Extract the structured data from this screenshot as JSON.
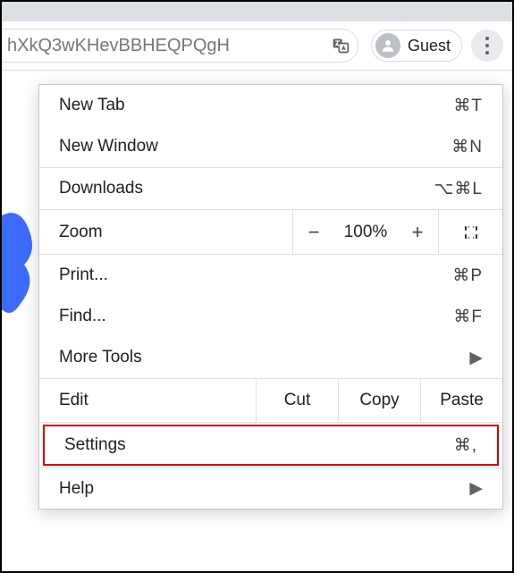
{
  "toolbar": {
    "url_fragment": "hXkQ3wKHevBBHEQPQgH",
    "guest_label": "Guest"
  },
  "menu": {
    "new_tab": {
      "label": "New Tab",
      "shortcut": "⌘T"
    },
    "new_window": {
      "label": "New Window",
      "shortcut": "⌘N"
    },
    "downloads": {
      "label": "Downloads",
      "shortcut": "⌥⌘L"
    },
    "zoom": {
      "label": "Zoom",
      "level": "100%"
    },
    "print": {
      "label": "Print...",
      "shortcut": "⌘P"
    },
    "find": {
      "label": "Find...",
      "shortcut": "⌘F"
    },
    "more_tools": {
      "label": "More Tools"
    },
    "edit": {
      "label": "Edit",
      "cut": "Cut",
      "copy": "Copy",
      "paste": "Paste"
    },
    "settings": {
      "label": "Settings",
      "shortcut": "⌘,"
    },
    "help": {
      "label": "Help"
    }
  }
}
